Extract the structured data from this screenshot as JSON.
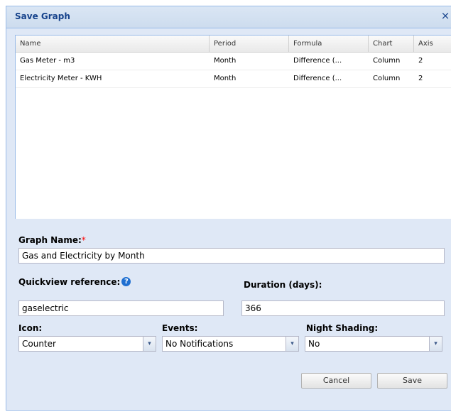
{
  "dialog": {
    "title": "Save Graph",
    "close_glyph": "×"
  },
  "grid": {
    "columns": [
      "Name",
      "Period",
      "Formula",
      "Chart",
      "Axis"
    ],
    "rows": [
      [
        "Gas Meter - m3",
        "Month",
        "Difference (...",
        "Column",
        "2"
      ],
      [
        "Electricity Meter - KWH",
        "Month",
        "Difference (...",
        "Column",
        "2"
      ]
    ]
  },
  "form": {
    "graph_name_label": "Graph Name:",
    "required_mark": "*",
    "graph_name_value": "Gas and Electricity by Month",
    "quickview_label": "Quickview reference:",
    "help_glyph": "?",
    "quickview_value": "gaselectric",
    "duration_label": "Duration (days):",
    "duration_value": "366",
    "icon_label": "Icon:",
    "icon_value": "Counter",
    "events_label": "Events:",
    "events_value": "No Notifications",
    "night_label": "Night Shading:",
    "night_value": "No",
    "dropdown_glyph": "▾"
  },
  "buttons": {
    "cancel": "Cancel",
    "save": "Save"
  },
  "colors": {
    "title": "#15428b",
    "panel": "#dfe8f6",
    "border": "#99bbe8",
    "help": "#1f6fd1"
  }
}
